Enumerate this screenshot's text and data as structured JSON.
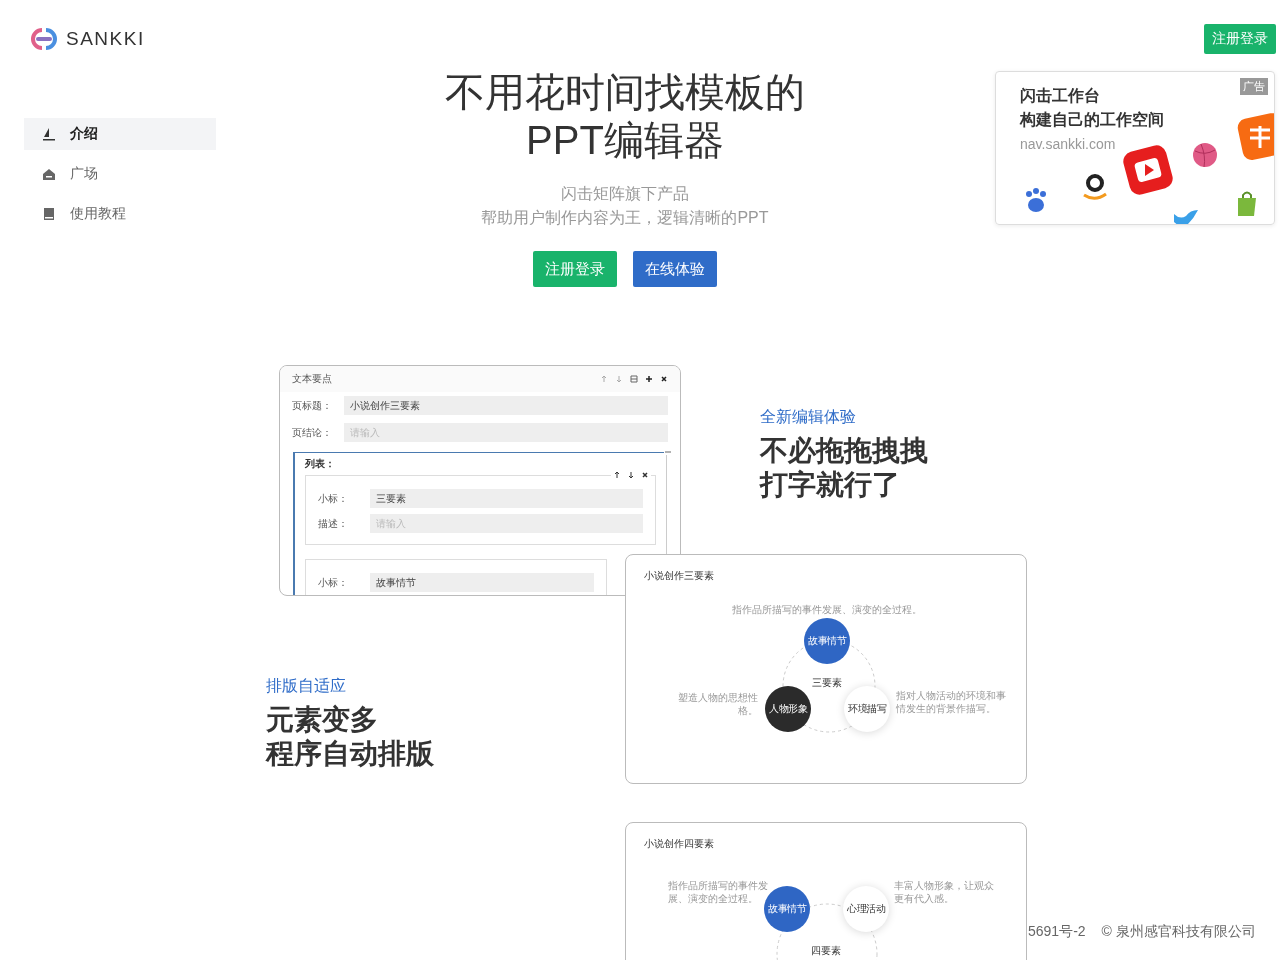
{
  "brand": {
    "name": "SANKKI"
  },
  "header_button": "注册登录",
  "sidebar": {
    "items": [
      {
        "label": "介绍",
        "selected": true,
        "kind": "boat"
      },
      {
        "label": "广场",
        "selected": false,
        "kind": "home"
      },
      {
        "label": "使用教程",
        "selected": false,
        "kind": "book"
      }
    ]
  },
  "hero": {
    "title_lines": [
      "不用花时间找模板的",
      "PPT编辑器"
    ],
    "subtitle_lines": [
      "闪击矩阵旗下产品",
      "帮助用户制作内容为王，逻辑清晰的PPT"
    ],
    "buttons": [
      {
        "label": "注册登录",
        "kind": "primary"
      },
      {
        "label": "在线体验",
        "kind": "secondary"
      }
    ]
  },
  "ad": {
    "badge": "广告",
    "lines": [
      "闪击工作台",
      "构建自己的工作空间"
    ],
    "url": "nav.sankki.com"
  },
  "editor_preview": {
    "title": "文本要点",
    "fields": [
      {
        "label": "页标题：",
        "value": "小说创作三要素"
      },
      {
        "label": "页结论：",
        "placeholder": "请输入"
      }
    ],
    "list": {
      "label": "列表：",
      "items": [
        {
          "fields": [
            {
              "label": "小标：",
              "value": "三要素"
            },
            {
              "label": "描述：",
              "placeholder": "请输入"
            }
          ]
        },
        {
          "fields": [
            {
              "label": "小标：",
              "value": "故事情节"
            }
          ]
        }
      ]
    }
  },
  "features": [
    {
      "eyebrow": "全新编辑体验",
      "headline_lines": [
        "不必拖拖拽拽",
        "打字就行了"
      ]
    },
    {
      "eyebrow": "排版自适应",
      "headline_lines": [
        "元素变多",
        "程序自动排版"
      ]
    }
  ],
  "slides": [
    {
      "title": "小说创作三要素",
      "kind": "three",
      "center_label": "三要素",
      "nodes": [
        {
          "label": "故事情节",
          "kind": "blue",
          "caption": "指作品所描写的事件发展、演变的全过程。"
        },
        {
          "label": "人物形象",
          "kind": "dark",
          "caption": "塑造人物的思想性格。"
        },
        {
          "label": "环境描写",
          "kind": "light",
          "caption": "指对人物活动的环境和事情发生的背景作描写。"
        }
      ]
    },
    {
      "title": "小说创作四要素",
      "kind": "four",
      "center_label": "四要素",
      "nodes": [
        {
          "label": "故事情节",
          "kind": "blue",
          "caption": "指作品所描写的事件发展、演变的全过程。"
        },
        {
          "label": "心理活动",
          "kind": "light",
          "caption": "丰富人物形象，让观众更有代入感。"
        }
      ]
    }
  ],
  "footer": {
    "record": "5691号-2",
    "copyright": "© 泉州感官科技有限公司"
  }
}
